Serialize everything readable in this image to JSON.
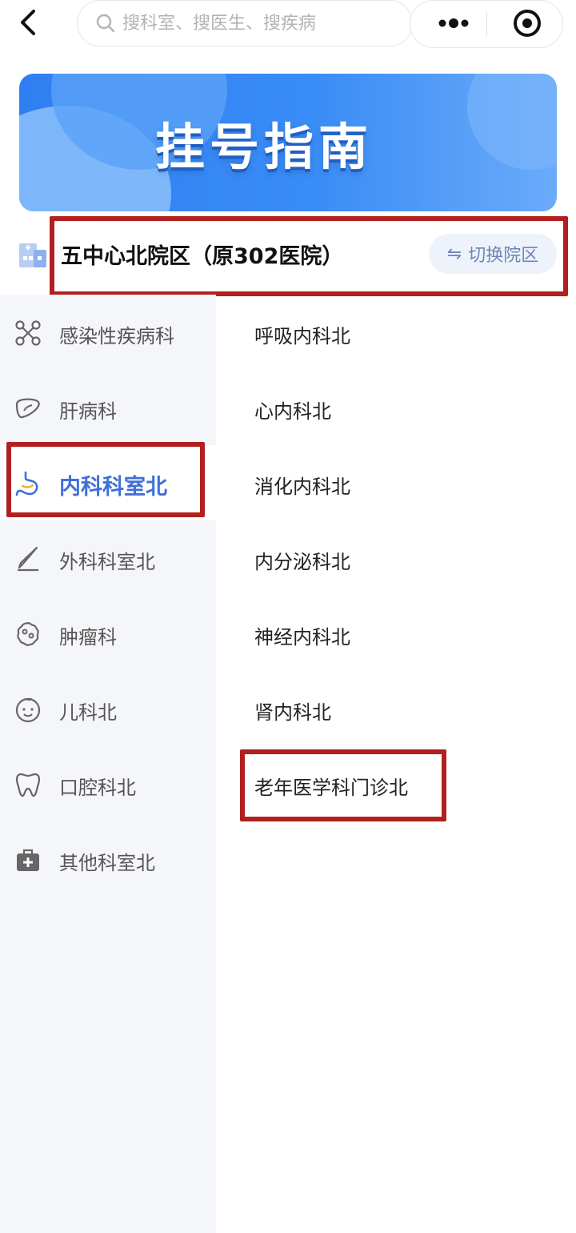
{
  "search": {
    "placeholder": "搜科室、搜医生、搜疾病"
  },
  "banner": {
    "title": "挂号指南"
  },
  "hospital": {
    "name": "五中心北院区（原302医院）",
    "switch_label": "切换院区",
    "switch_arrow": "⇋"
  },
  "sidebar": {
    "items": [
      {
        "label": "感染性疾病科",
        "icon": "molecule-icon"
      },
      {
        "label": "肝病科",
        "icon": "liver-icon"
      },
      {
        "label": "内科科室北",
        "icon": "stomach-icon",
        "active": true
      },
      {
        "label": "外科科室北",
        "icon": "scalpel-icon"
      },
      {
        "label": "肿瘤科",
        "icon": "cell-icon"
      },
      {
        "label": "儿科北",
        "icon": "baby-face-icon"
      },
      {
        "label": "口腔科北",
        "icon": "tooth-icon"
      },
      {
        "label": "其他科室北",
        "icon": "medkit-icon"
      }
    ]
  },
  "departments": [
    {
      "label": "呼吸内科北"
    },
    {
      "label": "心内科北"
    },
    {
      "label": "消化内科北"
    },
    {
      "label": "内分泌科北"
    },
    {
      "label": "神经内科北"
    },
    {
      "label": "肾内科北"
    },
    {
      "label": "老年医学科门诊北"
    }
  ],
  "colors": {
    "accent": "#3f6fd8",
    "highlight": "#b21f1f",
    "banner": "#2f7ff2",
    "sidebar_bg": "#f5f6f9"
  }
}
